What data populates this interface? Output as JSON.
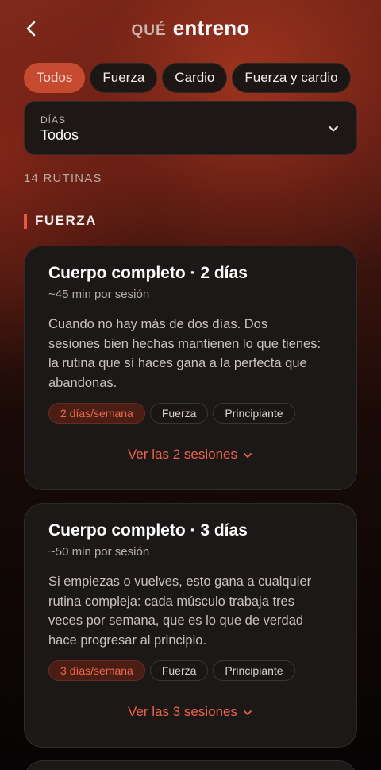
{
  "header": {
    "title_prefix": "QUÉ",
    "title_main": "entreno"
  },
  "filters": {
    "chips": [
      {
        "label": "Todos",
        "active": true
      },
      {
        "label": "Fuerza",
        "active": false
      },
      {
        "label": "Cardio",
        "active": false
      },
      {
        "label": "Fuerza y cardio",
        "active": false
      }
    ]
  },
  "days_select": {
    "label": "DÍAS",
    "value": "Todos"
  },
  "routine_count": "14 RUTINAS",
  "section": {
    "title": "FUERZA"
  },
  "cards": [
    {
      "title": "Cuerpo completo · 2 días",
      "subtitle": "~45 min por sesión",
      "description": "Cuando no hay más de dos días. Dos sesiones bien hechas mantienen lo que tienes: la rutina que sí haces gana a la perfecta que abandonas.",
      "tags": [
        "2 días/semana",
        "Fuerza",
        "Principiante"
      ],
      "link": "Ver las 2 sesiones"
    },
    {
      "title": "Cuerpo completo · 3 días",
      "subtitle": "~50 min por sesión",
      "description": "Si empiezas o vuelves, esto gana a cualquier rutina compleja: cada músculo trabaja tres veces por semana, que es lo que de verdad hace progresar al principio.",
      "tags": [
        "3 días/semana",
        "Fuerza",
        "Principiante"
      ],
      "link": "Ver las 3 sesiones"
    }
  ],
  "colors": {
    "accent": "#ef6244",
    "chip_active_bg": "#c64a30",
    "card_bg": "#1c1817"
  },
  "icons": {
    "back": "chevron-left-icon",
    "dropdown": "chevron-down-icon",
    "expand": "chevron-down-icon"
  }
}
